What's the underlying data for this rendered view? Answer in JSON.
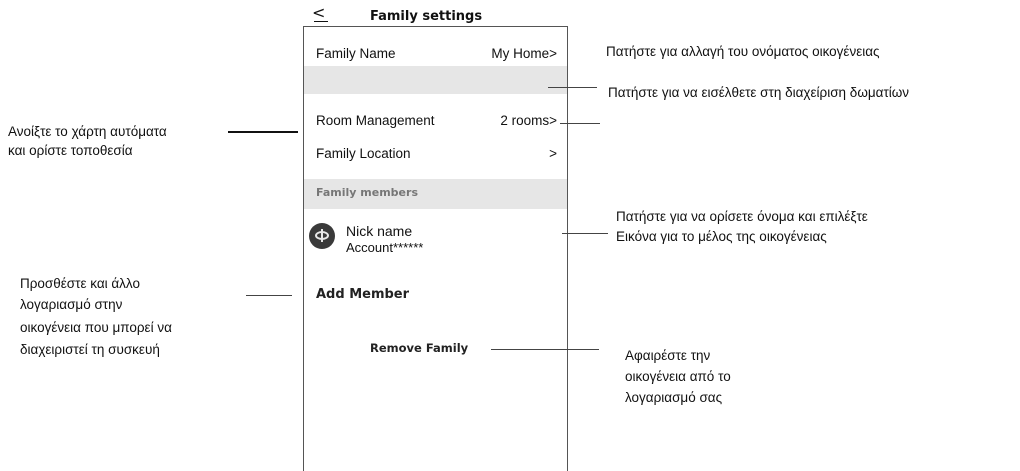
{
  "header": {
    "title": "Family settings"
  },
  "rows": {
    "family_name": {
      "label": "Family Name",
      "value": "My Home>"
    },
    "room_management": {
      "label": "Room Management",
      "value": "2 rooms>"
    },
    "family_location": {
      "label": "Family Location",
      "value": ">"
    }
  },
  "members": {
    "section_label": "Family members",
    "items": [
      {
        "nick": "Nick name",
        "account": "Account******"
      }
    ],
    "add_label": "Add Member"
  },
  "remove_label": "Remove Family",
  "annotations": {
    "rename": "Πατήστε για αλλαγή του ονόματος οικογένειας",
    "rooms": "Πατήστε για να εισέλθετε στη διαχείριση δωματίων",
    "map_line1": "Ανοίξτε το χάρτη αυτόματα",
    "map_line2": "και ορίστε τοποθεσία",
    "member_line1": "Πατήστε για να ορίσετε όνομα και επιλέξτε",
    "member_line2": "Εικόνα για το μέλος της οικογένειας",
    "add_line1": "Προσθέστε και άλλο",
    "add_line2": "λογαριασμό στην",
    "add_line3": "οικογένεια που μπορεί να",
    "add_line4": "διαχειριστεί τη συσκευή",
    "remove_line1": "Αφαιρέστε την",
    "remove_line2": "οικογένεια από το",
    "remove_line3": "λογαριασμό σας"
  }
}
